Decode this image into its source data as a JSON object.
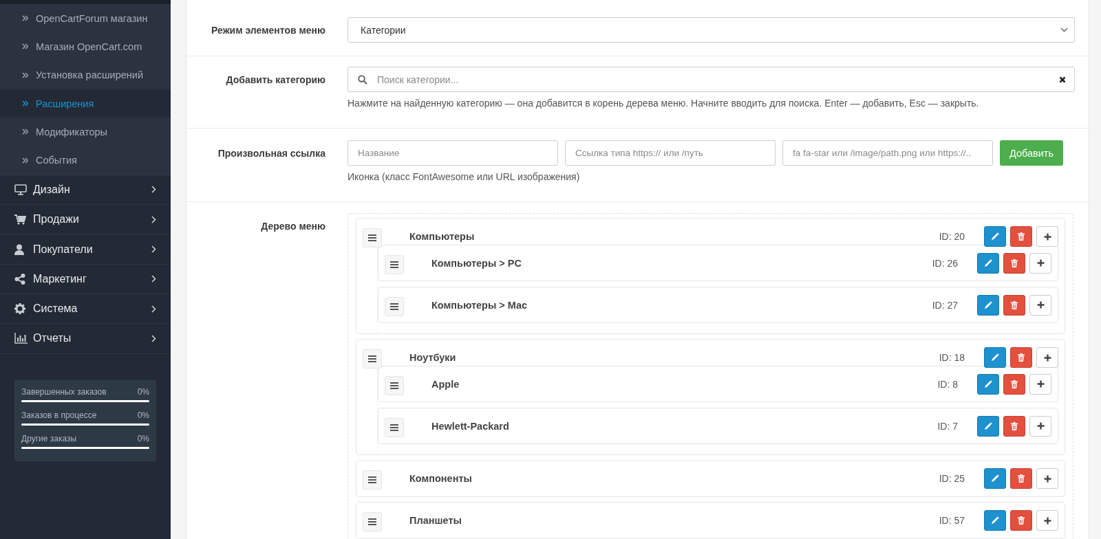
{
  "sidebar": {
    "submenu": [
      {
        "label": "OpenCartForum магазин",
        "selected": false
      },
      {
        "label": "Магазин OpenCart.com",
        "selected": false
      },
      {
        "label": "Установка расширений",
        "selected": false
      },
      {
        "label": "Расширения",
        "selected": true
      },
      {
        "label": "Модификаторы",
        "selected": false
      },
      {
        "label": "События",
        "selected": false
      }
    ],
    "menu": [
      {
        "label": "Дизайн"
      },
      {
        "label": "Продажи"
      },
      {
        "label": "Покупатели"
      },
      {
        "label": "Маркетинг"
      },
      {
        "label": "Система"
      },
      {
        "label": "Отчеты"
      }
    ],
    "stats": [
      {
        "label": "Завершенных заказов",
        "value": "0%",
        "level": 0
      },
      {
        "label": "Заказов в процессе",
        "value": "0%",
        "level": 0
      },
      {
        "label": "Другие заказы",
        "value": "0%",
        "level": 0
      }
    ]
  },
  "form": {
    "mode": {
      "label": "Режим элементов меню",
      "value": "Категории"
    },
    "add_category": {
      "label": "Добавить категорию",
      "placeholder": "Поиск категории...",
      "help": "Нажмите на найденную категорию — она добавится в корень дерева меню. Начните вводить для поиска. Enter — добавить, Esc — закрыть."
    },
    "custom_link": {
      "label": "Произвольная ссылка",
      "name_placeholder": "Название",
      "url_placeholder": "Ссылка типа https:// или /путь",
      "icon_placeholder": "fa fa-star или /image/path.png или https://..",
      "button": "Добавить",
      "help": "Иконка (класс FontAwesome или URL изображения)"
    },
    "tree": {
      "label": "Дерево меню",
      "items": [
        {
          "name": "Компьютеры",
          "id": "ID: 20",
          "children": [
            {
              "name": "Компьютеры > PC",
              "id": "ID: 26"
            },
            {
              "name": "Компьютеры > Mac",
              "id": "ID: 27"
            }
          ]
        },
        {
          "name": "Ноутбуки",
          "id": "ID: 18",
          "children": [
            {
              "name": "Apple",
              "id": "ID: 8"
            },
            {
              "name": "Hewlett-Packard",
              "id": "ID: 7"
            }
          ]
        },
        {
          "name": "Компоненты",
          "id": "ID: 25"
        },
        {
          "name": "Планшеты",
          "id": "ID: 57"
        }
      ]
    }
  }
}
